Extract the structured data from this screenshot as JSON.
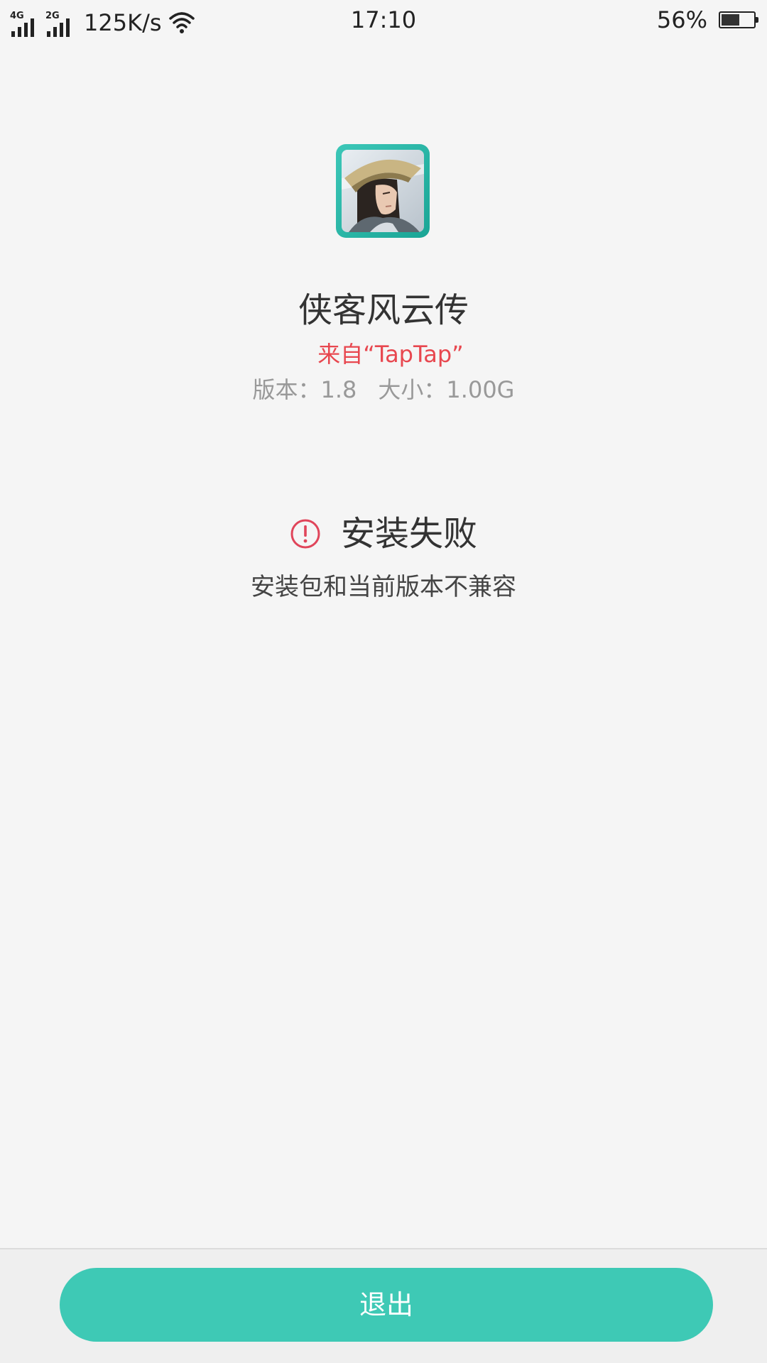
{
  "status_bar": {
    "signal_1_tag": "4G",
    "signal_2_tag": "2G",
    "net_speed": "125K/s",
    "time": "17:10",
    "battery_percent": "56%",
    "battery_level": 0.56
  },
  "app": {
    "name": "侠客风云传",
    "source": "来自“TapTap”",
    "version": "版本：1.8",
    "size": "大小：1.00G",
    "icon": "game-character-icon"
  },
  "install": {
    "status_icon": "warning-icon",
    "title": "安装失败",
    "reason": "安装包和当前版本不兼容"
  },
  "bottom": {
    "exit_label": "退出"
  },
  "colors": {
    "accent": "#3ec9b5",
    "error": "#e8474f",
    "background": "#f5f5f5"
  }
}
